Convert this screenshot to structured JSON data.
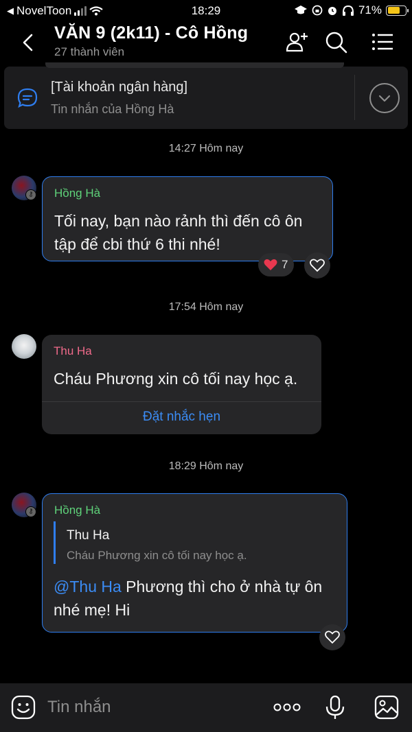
{
  "status_bar": {
    "back_app": "NovelToon",
    "time": "18:29",
    "battery": "71%",
    "battery_level": 0.71
  },
  "header": {
    "title": "VĂN 9 (2k11) - Cô Hồng",
    "subtitle": "27 thành viên",
    "icons": [
      "back-icon",
      "add-member-icon",
      "search-icon",
      "menu-icon"
    ]
  },
  "pinned": {
    "title": "[Tài khoản ngân hàng]",
    "subtitle": "Tin nhắn của Hồng Hà"
  },
  "messages": [
    {
      "timestamp": "14:27 Hôm nay",
      "sender": "Hồng Hà",
      "sender_color": "#5fd37a",
      "text_line1": "Tối nay, bạn nào rảnh thì đến cô ôn",
      "text_line2": "tập để cbi thứ 6 thi nhé!",
      "reaction_count": "7"
    },
    {
      "timestamp": "17:54 Hôm nay",
      "sender": "Thu Ha",
      "sender_color": "#ef6a8a",
      "text": "Cháu Phương xin cô tối nay học ạ.",
      "action": "Đặt nhắc hẹn"
    },
    {
      "timestamp": "18:29 Hôm nay",
      "sender": "Hồng Hà",
      "sender_color": "#5fd37a",
      "quote_name": "Thu Ha",
      "quote_text": "Cháu Phương xin cô tối nay học ạ.",
      "mention": "@Thu Ha",
      "text_line1": "Phương thì cho ở nhà tự ôn",
      "text_line2": "nhé mẹ! Hi"
    }
  ],
  "input": {
    "placeholder": "Tin nhắn",
    "more_label": "ooo"
  },
  "colors": {
    "accent": "#2f7ef0",
    "bubble": "#262628",
    "background": "#000000"
  }
}
